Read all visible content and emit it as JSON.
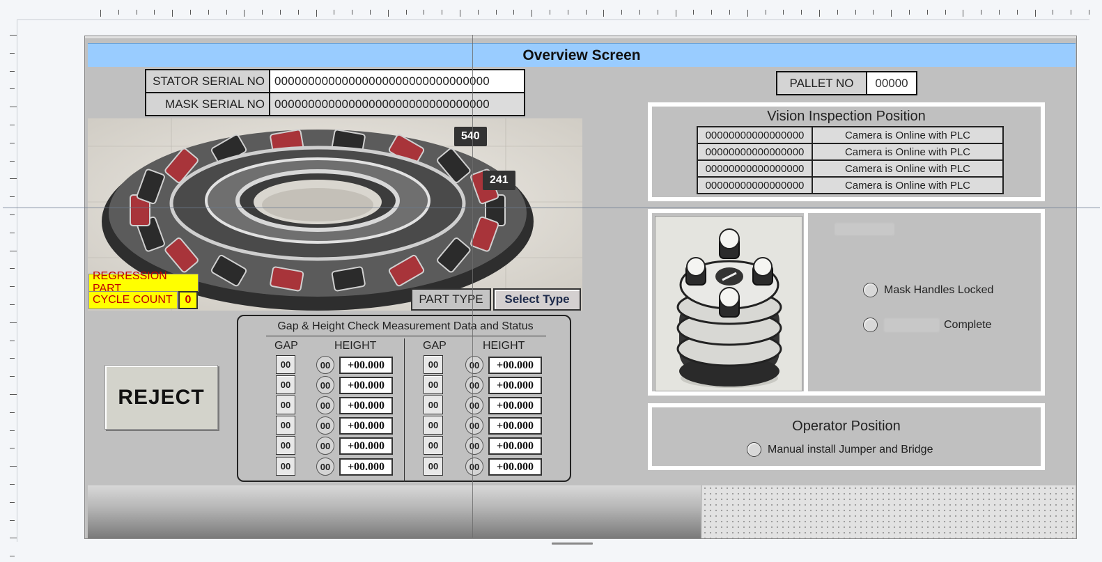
{
  "screen": {
    "title": "Overview Screen"
  },
  "serials": {
    "stator_label": "STATOR SERIAL NO",
    "stator_value": "00000000000000000000000000000000",
    "mask_label": "MASK SERIAL NO",
    "mask_value": "00000000000000000000000000000000"
  },
  "markers": {
    "tag_a": "540",
    "tag_b": "241"
  },
  "part": {
    "regression_label": "REGRESSION PART",
    "cycle_label": "CYCLE COUNT",
    "cycle_value": "0",
    "part_type_label": "PART TYPE",
    "select_type_label": "Select Type"
  },
  "reject": {
    "label": "REJECT"
  },
  "gap_height": {
    "title": "Gap & Height Check Measurement Data and Status",
    "gap_header": "GAP",
    "height_header": "HEIGHT",
    "rows_left": [
      {
        "gap": "00",
        "status": "00",
        "height": "+00.000"
      },
      {
        "gap": "00",
        "status": "00",
        "height": "+00.000"
      },
      {
        "gap": "00",
        "status": "00",
        "height": "+00.000"
      },
      {
        "gap": "00",
        "status": "00",
        "height": "+00.000"
      },
      {
        "gap": "00",
        "status": "00",
        "height": "+00.000"
      },
      {
        "gap": "00",
        "status": "00",
        "height": "+00.000"
      }
    ],
    "rows_right": [
      {
        "gap": "00",
        "status": "00",
        "height": "+00.000"
      },
      {
        "gap": "00",
        "status": "00",
        "height": "+00.000"
      },
      {
        "gap": "00",
        "status": "00",
        "height": "+00.000"
      },
      {
        "gap": "00",
        "status": "00",
        "height": "+00.000"
      },
      {
        "gap": "00",
        "status": "00",
        "height": "+00.000"
      },
      {
        "gap": "00",
        "status": "00",
        "height": "+00.000"
      }
    ]
  },
  "pallet": {
    "label": "PALLET NO",
    "value": "00000"
  },
  "vision": {
    "title": "Vision Inspection Position",
    "rows": [
      {
        "id": "00000000000000000",
        "status": "Camera is Online with PLC"
      },
      {
        "id": "00000000000000000",
        "status": "Camera is Online with PLC"
      },
      {
        "id": "00000000000000000",
        "status": "Camera is Online with PLC"
      },
      {
        "id": "00000000000000000",
        "status": "Camera is Online with PLC"
      }
    ]
  },
  "mask_station": {
    "handles_locked_label": "Mask Handles Locked",
    "complete_label": "Complete"
  },
  "operator": {
    "title": "Operator Position",
    "jumper_label": "Manual install Jumper and Bridge"
  },
  "colors": {
    "title_bar": "#99ccff",
    "screen_bg": "#c0c0c0",
    "highlight_yellow": "#ffff00",
    "alert_red": "#c00000"
  }
}
